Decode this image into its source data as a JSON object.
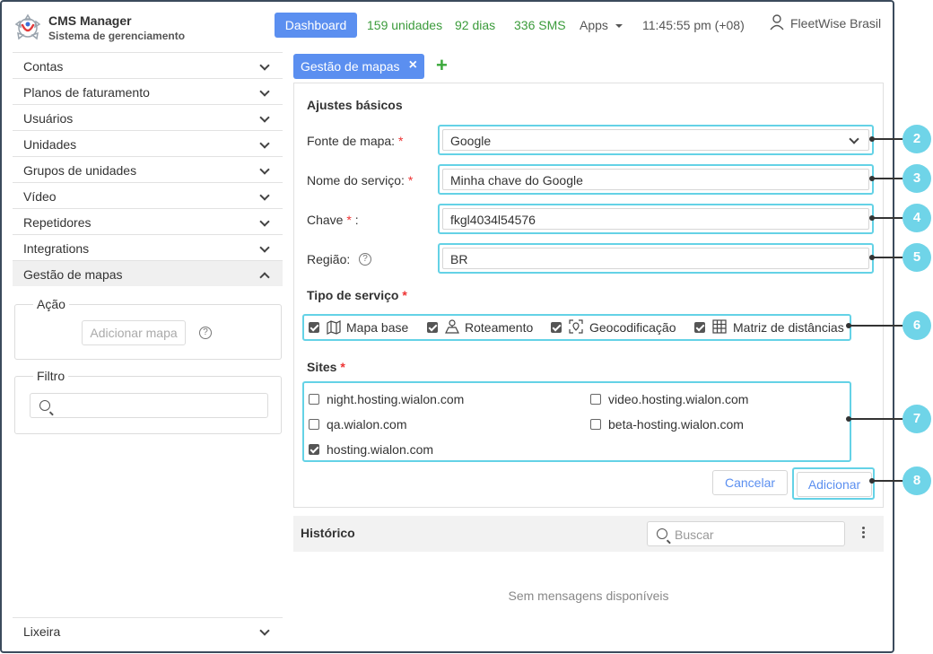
{
  "header": {
    "app_title": "CMS Manager",
    "app_subtitle": "Sistema de gerenciamento",
    "dashboard_label": "Dashboard",
    "units": "159 unidades",
    "days": "92 dias",
    "sms": "336 SMS",
    "apps_label": "Apps",
    "clock": "11:45:55 pm (+08)",
    "user_name": "FleetWise Brasil"
  },
  "sidebar": {
    "items": [
      {
        "label": "Contas"
      },
      {
        "label": "Planos de faturamento"
      },
      {
        "label": "Usuários"
      },
      {
        "label": "Unidades"
      },
      {
        "label": "Grupos de unidades"
      },
      {
        "label": "Vídeo"
      },
      {
        "label": "Repetidores"
      },
      {
        "label": "Integrations"
      },
      {
        "label": "Gestão de mapas"
      }
    ],
    "action_legend": "Ação",
    "add_map_label": "Adicionar mapa",
    "filter_legend": "Filtro",
    "trash_label": "Lixeira"
  },
  "tab": {
    "label": "Gestão de mapas",
    "close_glyph": "×",
    "add_glyph": "+"
  },
  "form": {
    "section_basic": "Ajustes básicos",
    "map_source_label": "Fonte de mapa:",
    "map_source_value": "Google",
    "service_name_label": "Nome do serviço:",
    "service_name_value": "Minha chave do Google",
    "key_label": "Chave",
    "key_value": "fkgl4034l54576",
    "region_label": "Região:",
    "region_value": "BR",
    "required_mark": "*",
    "key_colon": ":",
    "help_glyph": "?",
    "service_type_title": "Tipo de serviço",
    "service_types": [
      {
        "label": "Mapa base",
        "checked": true,
        "icon": "map-icon"
      },
      {
        "label": "Roteamento",
        "checked": true,
        "icon": "route-icon"
      },
      {
        "label": "Geocodificação",
        "checked": true,
        "icon": "geocode-icon"
      },
      {
        "label": "Matriz de distâncias",
        "checked": true,
        "icon": "grid-icon"
      }
    ],
    "sites_title": "Sites",
    "sites": [
      {
        "label": "night.hosting.wialon.com",
        "checked": false
      },
      {
        "label": "video.hosting.wialon.com",
        "checked": false
      },
      {
        "label": "qa.wialon.com",
        "checked": false
      },
      {
        "label": "beta-hosting.wialon.com",
        "checked": false
      },
      {
        "label": "hosting.wialon.com",
        "checked": true
      }
    ],
    "cancel_label": "Cancelar",
    "submit_label": "Adicionar"
  },
  "callouts": [
    "2",
    "3",
    "4",
    "5",
    "6",
    "7",
    "8"
  ],
  "history": {
    "title": "Histórico",
    "search_placeholder": "Buscar",
    "empty_message": "Sem mensagens disponíveis"
  },
  "colors": {
    "accent": "#5b8ff0",
    "success": "#3b9b3b",
    "highlight": "#64d2e6",
    "callout": "#6fd4e8",
    "required": "#ee3333"
  }
}
